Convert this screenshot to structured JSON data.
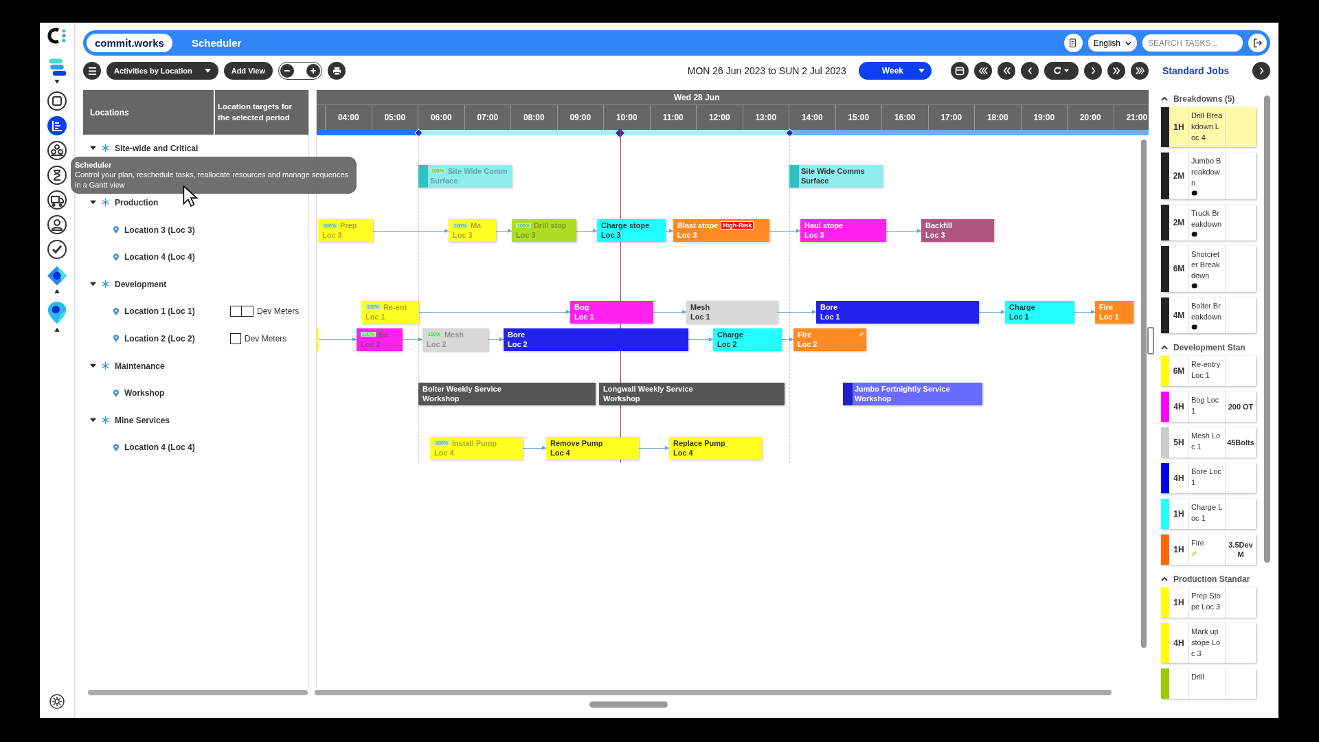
{
  "window": {
    "title": "Scheduler",
    "brand": "commit.works"
  },
  "header": {
    "language": "English",
    "search": {
      "placeholder": "SEARCH TASKS..."
    }
  },
  "nav": [
    {
      "kind": "layers",
      "selected": false
    },
    {
      "kind": "square",
      "selected": false
    },
    {
      "kind": "scheduler",
      "selected": true
    },
    {
      "kind": "people",
      "selected": false
    },
    {
      "kind": "hourglass",
      "selected": false
    },
    {
      "kind": "truck",
      "selected": false
    },
    {
      "kind": "user",
      "selected": false
    },
    {
      "kind": "check",
      "selected": false
    },
    {
      "kind": "diamond",
      "selected": false
    },
    {
      "kind": "pin",
      "selected": false
    }
  ],
  "toolbar": {
    "view": "Activities by Location",
    "add_view": "Add View",
    "range": "MON 26 Jun 2023 to SUN 2 Jul 2023",
    "period": "Week"
  },
  "tooltip": {
    "title": "Scheduler",
    "text": "Control your plan, reschedule tasks, reallocate resources and manage sequences in a Gantt view"
  },
  "table": {
    "columns": [
      "Locations",
      "Location targets for the selected period"
    ],
    "tree": [
      {
        "label": "Site-wide and Critical",
        "expanded": true
      },
      {
        "label": "Production",
        "expanded": true,
        "children": [
          {
            "label": "Location 3 (Loc 3)"
          },
          {
            "label": "Location 4 (Loc 4)"
          }
        ]
      },
      {
        "label": "Development",
        "expanded": true,
        "children": [
          {
            "label": "Location 1 (Loc 1)",
            "target": {
              "label": "Dev Meters",
              "kind": "double"
            }
          },
          {
            "label": "Location 2 (Loc 2)",
            "target": {
              "label": "Dev Meters",
              "kind": "single"
            }
          }
        ]
      },
      {
        "label": "Maintenance",
        "expanded": true,
        "children": [
          {
            "label": "Workshop"
          }
        ]
      },
      {
        "label": "Mine Services",
        "expanded": true,
        "children": [
          {
            "label": "Location 4 (Loc 4)"
          }
        ]
      }
    ]
  },
  "gantt": {
    "date": "Wed 28 Jun",
    "hours": [
      "04:00",
      "05:00",
      "06:00",
      "07:00",
      "08:00",
      "09:00",
      "10:00",
      "11:00",
      "12:00",
      "13:00",
      "14:00",
      "15:00",
      "16:00",
      "17:00",
      "18:00",
      "19:00",
      "20:00",
      "21:00"
    ],
    "lanes": [
      {
        "tasks": [
          {
            "title": "Site Wide Comm",
            "location": "Surface",
            "color": "#8eeeee",
            "stripe": true,
            "badge": "100%",
            "done": true,
            "edit_icon": false
          },
          {
            "title": "Site Wide Comms",
            "location": "Surface",
            "color": "#8eeeee",
            "stripe": true,
            "done": false,
            "edit_icon": false
          }
        ]
      },
      {
        "tasks": [
          {
            "title": "Prep",
            "location": "Loc 3",
            "color": "#ffff22",
            "badge": "100%",
            "done": true,
            "edit_icon": false
          },
          {
            "title": "Ma",
            "location": "Loc 3",
            "color": "#ffff22",
            "badge": "100%",
            "done": true,
            "edit_icon": false
          },
          {
            "title": "Drill stop",
            "location": "Loc 3",
            "color": "#aedd22",
            "badge": "100%",
            "done": true,
            "edit_icon": false
          },
          {
            "title": "Charge stope",
            "location": "Loc 3",
            "color": "#22ffff",
            "done": false,
            "edit_icon": false
          },
          {
            "title": "Blast stope",
            "location": "Loc 3",
            "color": "#ff8a22",
            "tag": "High-Risk",
            "done": false,
            "edit_icon": false
          },
          {
            "title": "Haul stope",
            "location": "Loc 3",
            "color": "#ff22ee",
            "done": false,
            "edit_icon": false
          },
          {
            "title": "Backfill",
            "location": "Loc 3",
            "color": "#b05580",
            "done": false,
            "edit_icon": false
          }
        ]
      },
      {
        "tasks": [
          {
            "title": "Re-ent",
            "location": "Loc 1",
            "color": "#ffff22",
            "badge": "100%",
            "done": true,
            "edit_icon": false
          },
          {
            "title": "Bog",
            "location": "Loc 1",
            "color": "#ff22ee",
            "done": false,
            "edit_icon": false
          },
          {
            "title": "Mesh",
            "location": "Loc 1",
            "color": "#d8d8d8",
            "done": false,
            "edit_icon": false
          },
          {
            "title": "Bore",
            "location": "Loc 1",
            "color": "#2222ee",
            "done": false,
            "edit_icon": false
          },
          {
            "title": "Charge",
            "location": "Loc 1",
            "color": "#22ffff",
            "done": false,
            "edit_icon": false
          },
          {
            "title": "Fire",
            "location": "Loc 1",
            "color": "#ff8a22",
            "done": false,
            "edit_icon": false
          }
        ]
      },
      {
        "tasks": [
          {
            "title": "Bo",
            "location": "Loc 2",
            "color": "#ff22ee",
            "badge": "100%",
            "done": true,
            "edit_icon": false
          },
          {
            "title": "Mesh",
            "location": "Loc 2",
            "color": "#d8d8d8",
            "badge": "100%",
            "done": true,
            "edit_icon": false
          },
          {
            "title": "Bore",
            "location": "Loc 2",
            "color": "#2222ee",
            "done": false,
            "edit_icon": false
          },
          {
            "title": "Charge",
            "location": "Loc 2",
            "color": "#22ffff",
            "done": false,
            "edit_icon": false
          },
          {
            "title": "Fire",
            "location": "Loc 2",
            "color": "#ff8a22",
            "done": false,
            "edit_icon": true
          }
        ]
      },
      {
        "tasks": [
          {
            "title": "Bolter Weekly Service",
            "location": "Workshop",
            "color": "#555555",
            "done": false,
            "edit_icon": false
          },
          {
            "title": "Longwall Weekly Service",
            "location": "Workshop",
            "color": "#555555",
            "done": false,
            "edit_icon": false
          },
          {
            "title": "Jumbo Fortnightly Service",
            "location": "Workshop",
            "color": "#6b6bff",
            "stripe": true,
            "done": false,
            "edit_icon": false
          }
        ]
      },
      {
        "tasks": [
          {
            "title": "Install Pump",
            "location": "Loc 4",
            "color": "#ffff22",
            "badge": "100%",
            "done": true,
            "edit_icon": false
          },
          {
            "title": "Remove Pump",
            "location": "Loc 4",
            "color": "#ffff22",
            "done": false,
            "edit_icon": false
          },
          {
            "title": "Replace Pump",
            "location": "Loc 4",
            "color": "#ffff22",
            "done": false,
            "edit_icon": false
          }
        ]
      }
    ]
  },
  "standard_jobs": {
    "title": "Standard Jobs",
    "groups": [
      {
        "title": "Breakdowns (5)",
        "expanded": true,
        "items": [
          {
            "duration": "1H",
            "name": "Drill Breakdown Loc 4",
            "color": "#222222",
            "selected": true,
            "indicator": false,
            "edit_icon": false
          },
          {
            "duration": "2M",
            "name": "Jumbo Breakdown",
            "color": "#222222",
            "selected": false,
            "indicator": true,
            "edit_icon": false
          },
          {
            "duration": "2M",
            "name": "Truck Breakdown",
            "color": "#222222",
            "selected": false,
            "indicator": true,
            "edit_icon": false
          },
          {
            "duration": "6M",
            "name": "Shotcreter Breakdown",
            "color": "#222222",
            "selected": false,
            "indicator": true,
            "edit_icon": false
          },
          {
            "duration": "4M",
            "name": "Bolter Breakdown",
            "color": "#222222",
            "selected": false,
            "indicator": true,
            "edit_icon": false
          }
        ]
      },
      {
        "title": "Development Stan",
        "expanded": true,
        "items": [
          {
            "duration": "6M",
            "name": "Re-entry Loc 1",
            "color": "#ffff00",
            "selected": false,
            "indicator": false,
            "edit_icon": false
          },
          {
            "duration": "4H",
            "name": "Bog Loc 1",
            "note": "200 OT",
            "color": "#ff00ff",
            "selected": false,
            "indicator": false,
            "edit_icon": false
          },
          {
            "duration": "5H",
            "name": "Mesh Loc 1",
            "note": "45Bolts",
            "color": "#cccccc",
            "selected": false,
            "indicator": false,
            "edit_icon": false
          },
          {
            "duration": "4H",
            "name": "Bore Loc 1",
            "color": "#0000ee",
            "selected": false,
            "indicator": false,
            "edit_icon": false
          },
          {
            "duration": "1H",
            "name": "Charge Loc 1",
            "color": "#22ffff",
            "selected": false,
            "indicator": false,
            "edit_icon": false
          },
          {
            "duration": "1H",
            "name": "Fire",
            "note": "3.5DevM",
            "color": "#ff6a00",
            "selected": false,
            "indicator": false,
            "edit_icon": true
          }
        ]
      },
      {
        "title": "Production Standar",
        "expanded": true,
        "items": [
          {
            "duration": "1H",
            "name": "Prep Stope Loc 3",
            "color": "#ffff00",
            "selected": false,
            "indicator": false,
            "edit_icon": false
          },
          {
            "duration": "4H",
            "name": "Mark up stope Loc 3",
            "color": "#ffff00",
            "selected": false,
            "indicator": false,
            "edit_icon": false
          },
          {
            "name": "Drill",
            "color": "#99cc00",
            "selected": false,
            "indicator": false,
            "edit_icon": false
          }
        ]
      }
    ]
  }
}
